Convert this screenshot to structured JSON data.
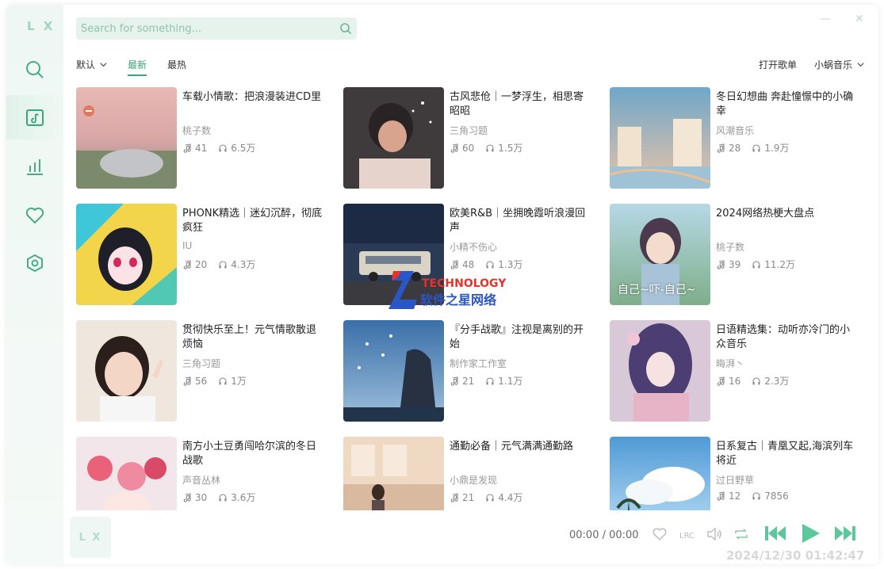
{
  "app": {
    "logo_text": "L X",
    "player_logo_text": "L X"
  },
  "search": {
    "placeholder": "Search for something..."
  },
  "sort": {
    "selected": "默认"
  },
  "tabs": [
    {
      "label": "最新",
      "active": true
    },
    {
      "label": "最热",
      "active": false
    }
  ],
  "actions": {
    "open_playlist": "打开歌单",
    "source": "小蜗音乐"
  },
  "nav_icons": [
    "search-icon",
    "music-library-icon",
    "chart-icon",
    "heart-icon",
    "settings-icon"
  ],
  "playlists": [
    {
      "title": "车载小情歌：把浪漫装进CD里",
      "author": "桃子数",
      "songs": "41",
      "plays": "6.5万"
    },
    {
      "title": "古风悲伧｜一梦浮生，相思寄昭昭",
      "author": "三角习题",
      "songs": "60",
      "plays": "1.5万"
    },
    {
      "title": "冬日幻想曲 奔赴憧憬中的小确幸",
      "author": "风潮音乐",
      "songs": "28",
      "plays": "1.9万"
    },
    {
      "title": "PHONK精选｜迷幻沉醉，彻底疯狂",
      "author": "IU",
      "songs": "20",
      "plays": "4.3万"
    },
    {
      "title": "欧美R&B｜坐拥晚霞听浪漫回声",
      "author": "小精不伤心",
      "songs": "48",
      "plays": "1.3万"
    },
    {
      "title": "2024网络热梗大盘点",
      "author": "桃子数",
      "songs": "39",
      "plays": "11.2万"
    },
    {
      "title": "贯彻快乐至上！元气情歌散退烦恼",
      "author": "三角习题",
      "songs": "56",
      "plays": "1万"
    },
    {
      "title": "『分手战歌』注视是离别的开始",
      "author": "制作家工作室",
      "songs": "21",
      "plays": "1.1万"
    },
    {
      "title": "日语精选集：动听亦冷门的小众音乐",
      "author": "晦湃丶",
      "songs": "16",
      "plays": "2.3万"
    },
    {
      "title": "南方小土豆勇闯哈尔滨的冬日战歌",
      "author": "声音丛林",
      "songs": "30",
      "plays": "3.6万"
    },
    {
      "title": "通勤必备｜元气满满通勤路",
      "author": "小鼎是发现",
      "songs": "21",
      "plays": "4.4万"
    },
    {
      "title": "日系复古｜青凰又起,海滨列车将近",
      "author": "过日野草",
      "songs": "12",
      "plays": "7856"
    }
  ],
  "cover_text": {
    "card6": "自己~吓-自己~"
  },
  "player": {
    "time": "00:00 / 00:00",
    "lyric_label": "LRC"
  },
  "watermark": {
    "date": "2024/12/30 01:42:47",
    "brand_en": "TECHNOLOGY",
    "brand_cn": "软件之星网络"
  },
  "colors": {
    "accent": "#3aa57b",
    "sidebar_bg": "#eef7f3",
    "search_bg": "#e6f3ed"
  }
}
